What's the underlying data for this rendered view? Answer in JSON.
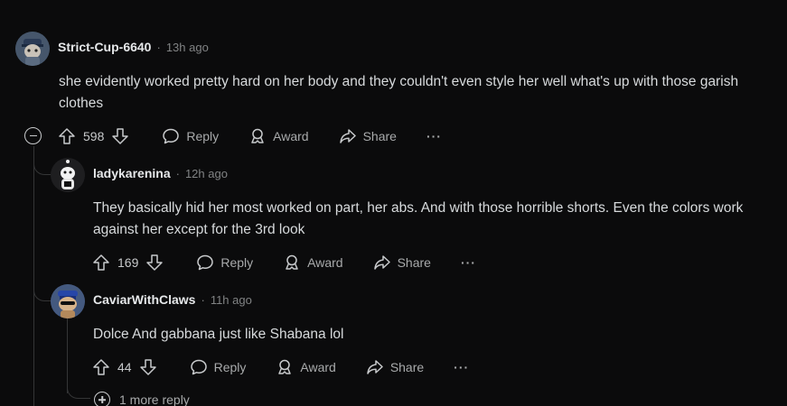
{
  "comments": [
    {
      "username": "Strict-Cup-6640",
      "time": "13h ago",
      "body": "she evidently worked pretty hard on her body and they couldn't even style her well what's up with those garish clothes",
      "votes": "598",
      "reply_label": "Reply",
      "award_label": "Award",
      "share_label": "Share",
      "more_label": "···"
    },
    {
      "username": "ladykarenina",
      "time": "12h ago",
      "body": "They basically hid her most worked on part, her abs. And with those horrible shorts. Even the colors work against her except for the 3rd look",
      "votes": "169",
      "reply_label": "Reply",
      "award_label": "Award",
      "share_label": "Share",
      "more_label": "···"
    },
    {
      "username": "CaviarWithClaws",
      "time": "11h ago",
      "body": "Dolce And gabbana just like Shabana lol",
      "votes": "44",
      "reply_label": "Reply",
      "award_label": "Award",
      "share_label": "Share",
      "more_label": "···"
    }
  ],
  "separator": "·",
  "more_replies": "1 more reply",
  "colors": {
    "background": "#0b0b0c",
    "text": "#d7dadc",
    "muted": "#818384",
    "thread_line": "#343536"
  }
}
